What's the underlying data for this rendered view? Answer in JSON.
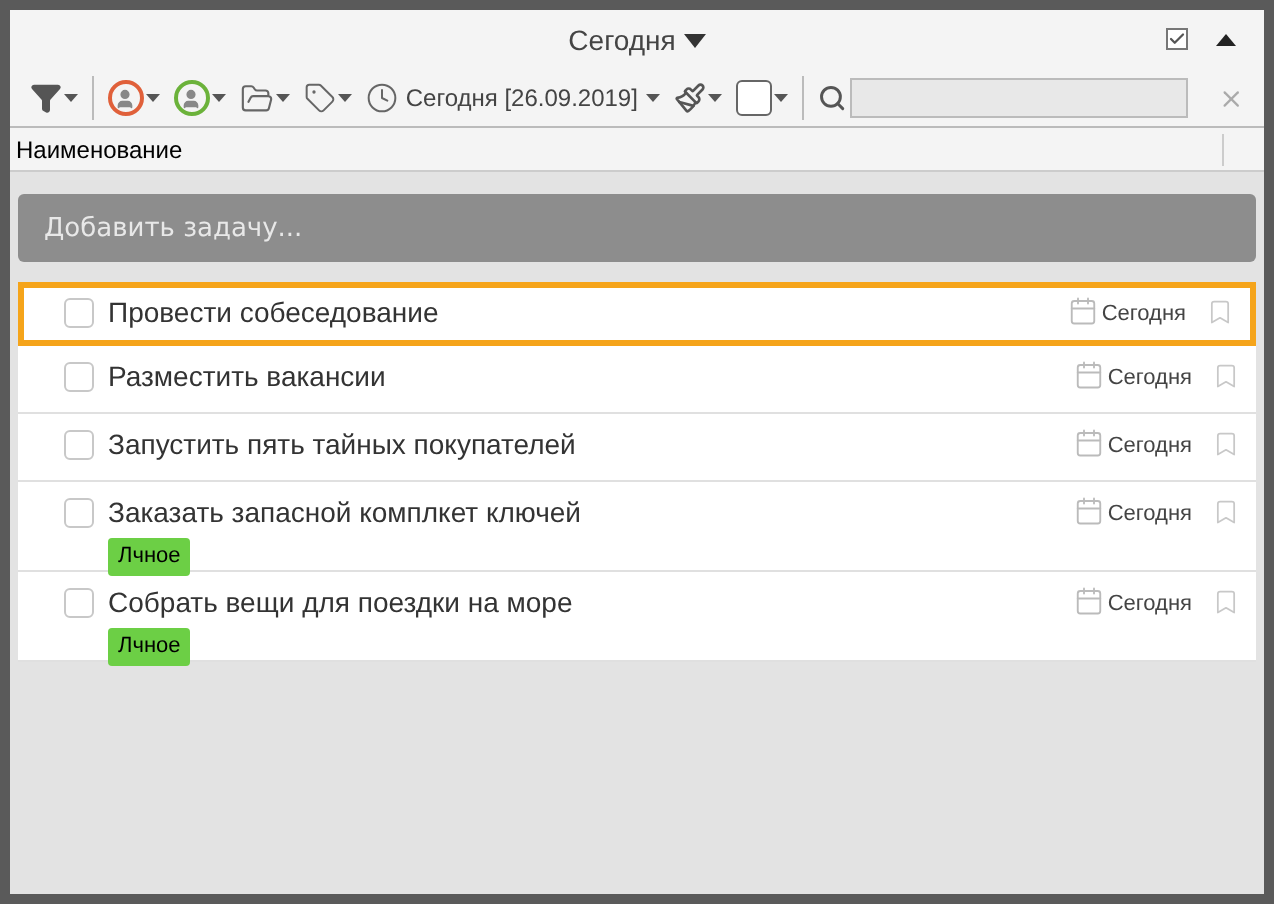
{
  "header": {
    "title": "Сегодня",
    "show_completed": true
  },
  "toolbar": {
    "date_filter": "Сегодня [26.09.2019]"
  },
  "table": {
    "columns": [
      "Наименование"
    ]
  },
  "add_task": {
    "placeholder": "Добавить задачу..."
  },
  "tasks": [
    {
      "title": "Провести собеседование",
      "checked": false,
      "selected": true,
      "due": "Сегодня"
    },
    {
      "title": "Разместить вакансии",
      "checked": false,
      "selected": false,
      "due": "Сегодня"
    },
    {
      "title": "Запустить пять тайных покупателей",
      "checked": false,
      "selected": false,
      "due": "Сегодня"
    },
    {
      "title": "Заказать запасной комплкет ключей",
      "checked": false,
      "selected": false,
      "due": "Сегодня",
      "tags": [
        {
          "label": "Лчное",
          "color": "#6ccf45"
        }
      ]
    },
    {
      "title": "Собрать вещи для поездки на море",
      "checked": false,
      "selected": false,
      "due": "Сегодня",
      "tags": [
        {
          "label": "Лчное",
          "color": "#6ccf45"
        }
      ]
    }
  ]
}
